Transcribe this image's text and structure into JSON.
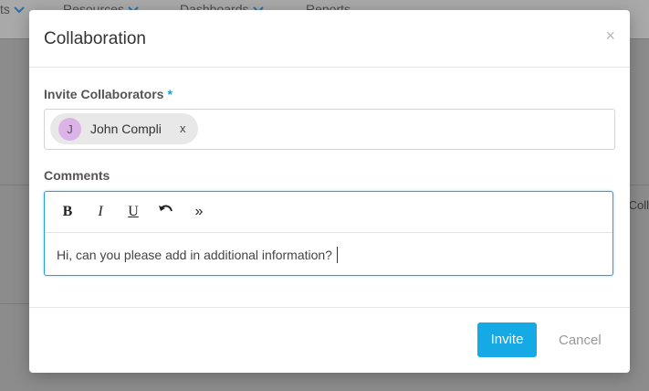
{
  "background": {
    "nav": [
      {
        "label": "ts"
      },
      {
        "label": "Resources"
      },
      {
        "label": "Dashboards"
      },
      {
        "label": "Reports"
      }
    ],
    "side_text": "Coll"
  },
  "modal": {
    "title": "Collaboration",
    "close_symbol": "×",
    "invite": {
      "label": "Invite Collaborators",
      "required_mark": "*",
      "chips": [
        {
          "initial": "J",
          "name": "John Compli",
          "remove": "x"
        }
      ]
    },
    "comments": {
      "label": "Comments",
      "toolbar": {
        "bold": "B",
        "italic": "I",
        "underline": "U",
        "undo_icon": "undo-icon",
        "quote": "»"
      },
      "text": "Hi, can you please add in additional information?"
    },
    "buttons": {
      "invite": "Invite",
      "cancel": "Cancel"
    }
  },
  "colors": {
    "accent": "#15a9e6",
    "required": "#1f9ec8",
    "avatar": "#dcb3e6"
  }
}
